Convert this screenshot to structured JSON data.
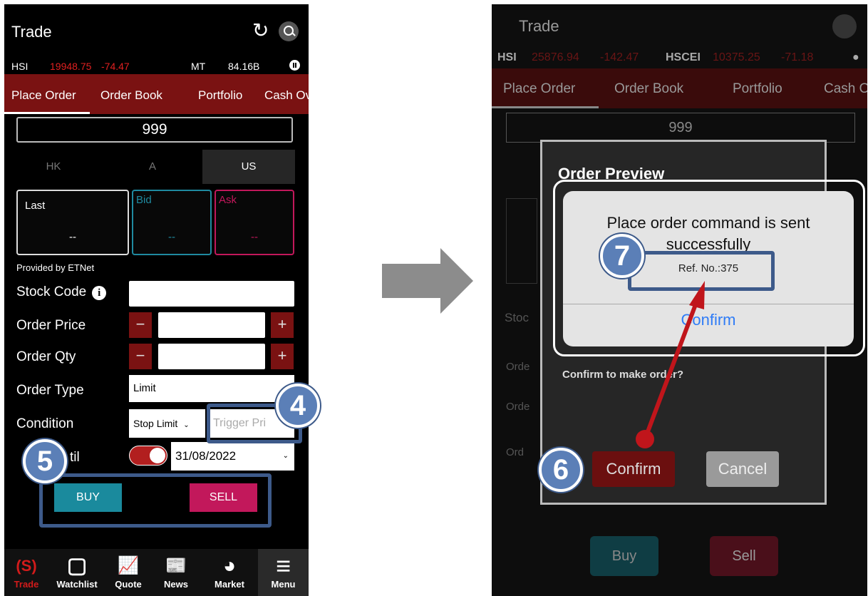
{
  "left": {
    "title": "Trade",
    "ticker": {
      "index": "HSI",
      "value": "19948.75",
      "change": "-74.47",
      "mt_label": "MT",
      "mt_value": "84.16B"
    },
    "tabs": [
      "Place Order",
      "Order Book",
      "Portfolio",
      "Cash Ov"
    ],
    "stock_code_value": "999",
    "markets": [
      "HK",
      "A",
      "US"
    ],
    "quote_boxes": [
      {
        "label": "Last",
        "value": "--"
      },
      {
        "label": "Bid",
        "value": "--"
      },
      {
        "label": "Ask",
        "value": "--"
      }
    ],
    "provided_by": "Provided by ETNet",
    "labels": {
      "stock_code": "Stock Code",
      "order_price": "Order Price",
      "order_qty": "Order Qty",
      "order_type": "Order Type",
      "condition": "Condition",
      "valid_until": "til"
    },
    "order_type_value": "Limit",
    "condition_value": "Stop Limit",
    "trigger_placeholder": "Trigger Pri",
    "date_value": "31/08/2022",
    "buy_label": "BUY",
    "sell_label": "SELL",
    "nav": [
      {
        "icon": "(S)",
        "label": "Trade"
      },
      {
        "icon": "▢",
        "label": "Watchlist"
      },
      {
        "icon": "📈",
        "label": "Quote"
      },
      {
        "icon": "📰",
        "label": "News"
      },
      {
        "icon": "◕",
        "label": "Market"
      },
      {
        "icon": "≡",
        "label": "Menu"
      }
    ]
  },
  "right": {
    "title": "Trade",
    "ticker": {
      "index1": "HSI",
      "value1": "25876.94",
      "change1": "-142.47",
      "index2": "HSCEI",
      "value2": "10375.25",
      "change2": "-71.18"
    },
    "tabs": [
      "Place Order",
      "Order Book",
      "Portfolio",
      "Cash O"
    ],
    "stock_code_value": "999",
    "modal_title": "Order Preview",
    "confirm_question": "Confirm to make order?",
    "confirm_label": "Confirm",
    "cancel_label": "Cancel",
    "alert": {
      "message": "Place order command is sent successfully",
      "ref": "Ref. No.:375",
      "confirm": "Confirm"
    },
    "buy_label": "Buy",
    "sell_label": "Sell"
  },
  "callouts": [
    "4",
    "5",
    "6",
    "7"
  ],
  "colors": {
    "accent": "#7a1212",
    "callout": "#5b7fb7",
    "arrow": "#c0151b",
    "ios_blue": "#2f7cf6"
  }
}
